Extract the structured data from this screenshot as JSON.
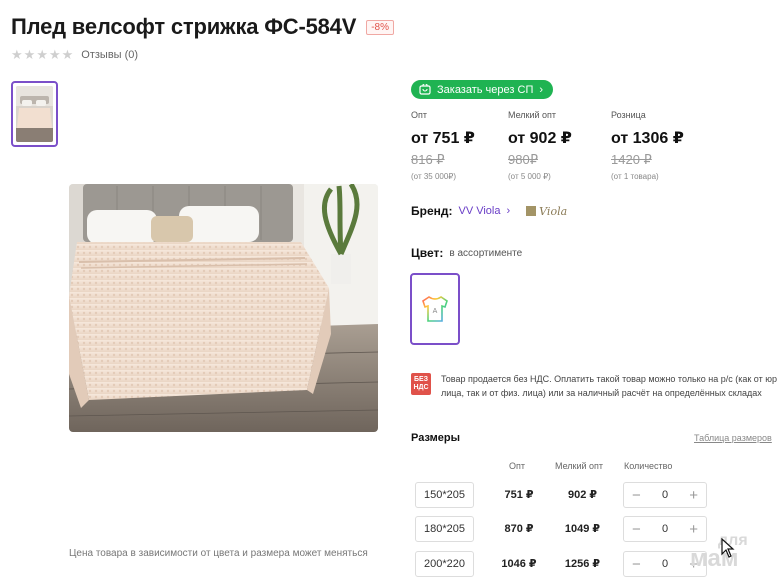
{
  "product": {
    "title": "Плед велсофт стрижка ФС-584V",
    "discount": "-8%",
    "reviews": "Отзывы (0)"
  },
  "order_button": {
    "label": "Заказать через СП",
    "chevron": "›",
    "icon": "cart-icon"
  },
  "prices": [
    {
      "label": "Опт",
      "value": "от 751 ₽",
      "old": "816 ₽",
      "min": "(от 35 000₽)"
    },
    {
      "label": "Мелкий опт",
      "value": "от 902 ₽",
      "old": "980₽",
      "min": "(от 5 000 ₽)"
    },
    {
      "label": "Розница",
      "value": "от 1306 ₽",
      "old": "1420 ₽",
      "min": "(от 1 товара)"
    }
  ],
  "brand": {
    "label": "Бренд:",
    "name": "VV Viola",
    "chevron": "›",
    "logo_text": "Viola"
  },
  "color": {
    "label": "Цвет:",
    "value": "в ассортименте",
    "swatch_letter": "A"
  },
  "vat": {
    "badge": "БЕЗ НДС",
    "text": "Товар продается без НДС. Оплатить такой товар можно только на р/с (как от юр. лица, так и от физ. лица) или за наличный расчёт на определённых складах"
  },
  "sizes": {
    "title": "Размеры",
    "table_link": "Таблица размеров",
    "columns": {
      "opt": "Опт",
      "small_opt": "Мелкий опт",
      "qty": "Количество"
    },
    "rows": [
      {
        "size": "150*205",
        "opt": "751 ₽",
        "small_opt": "902 ₽",
        "qty": "0"
      },
      {
        "size": "180*205",
        "opt": "870 ₽",
        "small_opt": "1049 ₽",
        "qty": "0"
      },
      {
        "size": "200*220",
        "opt": "1046 ₽",
        "small_opt": "1256 ₽",
        "qty": "0"
      }
    ],
    "minus": "−",
    "plus": "+"
  },
  "price_note": "Цена товара в зависимости от цвета и размера может меняться",
  "watermark": {
    "line1": "для",
    "line2": "мам"
  },
  "colors": {
    "accent": "#7b4fc9",
    "green": "#1fb352",
    "red": "#e0524a"
  }
}
